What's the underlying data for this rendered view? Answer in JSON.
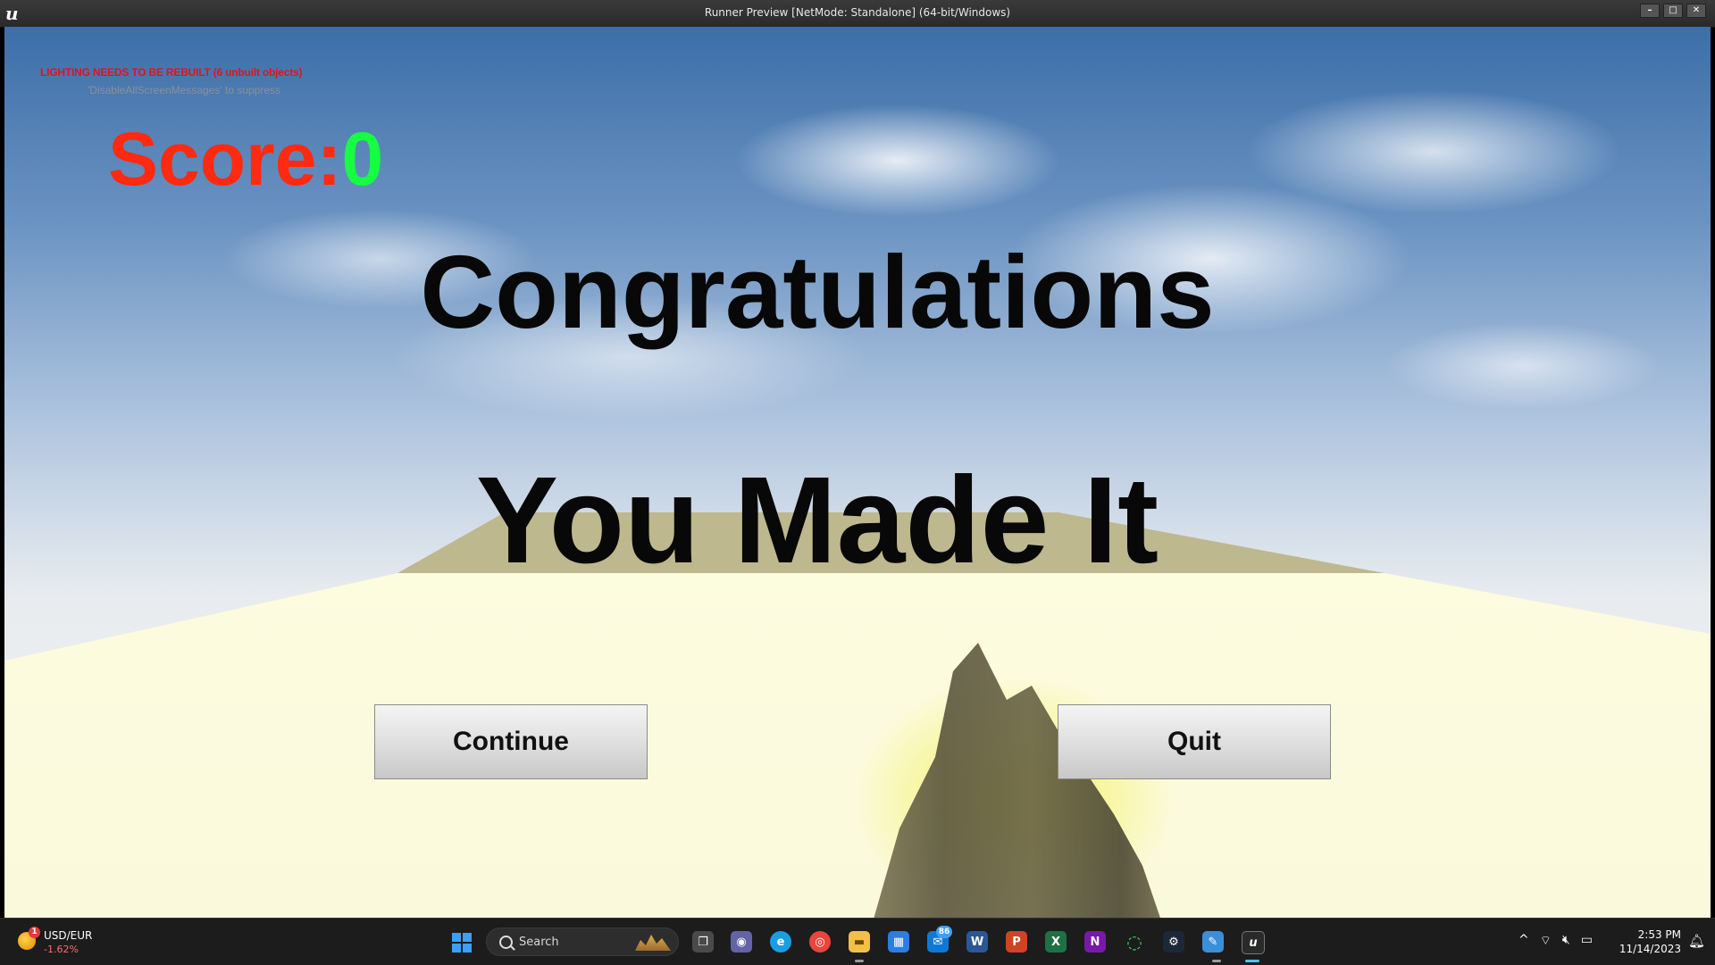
{
  "window": {
    "title": "Runner Preview [NetMode: Standalone]  (64-bit/Windows)",
    "min_icon": "minimize-icon",
    "max_icon": "maximize-icon",
    "close_icon": "close-icon"
  },
  "game": {
    "lighting_warning": "LIGHTING NEEDS TO BE REBUILT (6 unbuilt objects)",
    "suppress_hint": "'DisableAllScreenMessages' to suppress",
    "score_label": "Score:",
    "score_value": "0",
    "headline_1": "Congratulations",
    "headline_2": "You Made It",
    "continue_label": "Continue",
    "quit_label": "Quit",
    "colors": {
      "score_label": "#ff2a10",
      "score_value": "#16ff43",
      "warning": "#e0141c"
    }
  },
  "taskbar": {
    "widget": {
      "title": "USD/EUR",
      "change": "-1.62%",
      "badge": "1"
    },
    "search_placeholder": "Search",
    "mail_badge": "86",
    "apps": [
      {
        "name": "task-view-icon",
        "glyph": "❐"
      },
      {
        "name": "teams-icon",
        "glyph": "◉"
      },
      {
        "name": "edge-icon",
        "glyph": "e"
      },
      {
        "name": "chrome-icon",
        "glyph": "◎"
      },
      {
        "name": "file-explorer-icon",
        "glyph": "▬"
      },
      {
        "name": "store-icon",
        "glyph": "▦"
      },
      {
        "name": "mail-icon",
        "glyph": "✉"
      },
      {
        "name": "word-icon",
        "glyph": "W"
      },
      {
        "name": "powerpoint-icon",
        "glyph": "P"
      },
      {
        "name": "excel-icon",
        "glyph": "X"
      },
      {
        "name": "onenote-icon",
        "glyph": "N"
      },
      {
        "name": "loading-app-icon",
        "glyph": "◌"
      },
      {
        "name": "steam-icon",
        "glyph": "⚙"
      },
      {
        "name": "paint-icon",
        "glyph": "✎"
      },
      {
        "name": "unreal-engine-icon",
        "glyph": "u"
      }
    ],
    "tray": {
      "chevron": "^",
      "wifi": "wifi-icon",
      "volume": "volume-muted-icon",
      "battery": "battery-icon"
    },
    "time": "2:53 PM",
    "date": "11/14/2023"
  }
}
